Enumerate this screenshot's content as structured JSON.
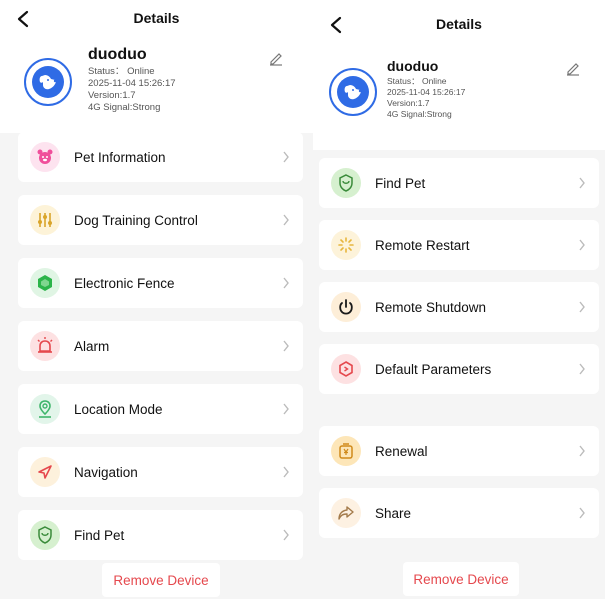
{
  "screens": [
    {
      "nav": {
        "title": "Details"
      },
      "device": {
        "name": "duoduo",
        "status": "Status： Online",
        "datetime": "2025-11-04 15:26:17",
        "version": "Version:1.7",
        "signal": "4G Signal:Strong"
      },
      "menu": [
        {
          "label": "Pet Information",
          "icon": "pet-face-icon",
          "color": "#f04f9b",
          "bg": "#fde3ef"
        },
        {
          "label": "Dog Training Control",
          "icon": "sliders-icon",
          "color": "#d9a52a",
          "bg": "#fdf3d8"
        },
        {
          "label": "Electronic Fence",
          "icon": "fence-icon",
          "color": "#2cb44a",
          "bg": "#e0f5e4"
        },
        {
          "label": "Alarm",
          "icon": "alarm-icon",
          "color": "#e5484d",
          "bg": "#fde1e2"
        },
        {
          "label": "Location Mode",
          "icon": "location-pin-icon",
          "color": "#3fb56b",
          "bg": "#e2f5ea"
        },
        {
          "label": "Navigation",
          "icon": "navigation-arrow-icon",
          "color": "#e5484d",
          "bg": "#fdf1dc"
        },
        {
          "label": "Find Pet",
          "icon": "find-pet-icon",
          "color": "#3a8b3a",
          "bg": "#d6f0cf"
        }
      ],
      "remove_label": "Remove Device"
    },
    {
      "nav": {
        "title": "Details"
      },
      "device": {
        "name": "duoduo",
        "status": "Status： Online",
        "datetime": "2025-11-04 15:26:17",
        "version": "Version:1.7",
        "signal": "4G Signal:Strong"
      },
      "menu": [
        {
          "label": "Find Pet",
          "icon": "find-pet-icon",
          "color": "#3a8b3a",
          "bg": "#d6f0cf"
        },
        {
          "label": "Remote Restart",
          "icon": "restart-icon",
          "color": "#e7b63c",
          "bg": "#fdf3da"
        },
        {
          "label": "Remote Shutdown",
          "icon": "power-icon",
          "color": "#1a1a1a",
          "bg": "#fdeed8"
        },
        {
          "label": "Default Parameters",
          "icon": "settings-hex-icon",
          "color": "#e5484d",
          "bg": "#fde1e2"
        },
        {
          "label": "Renewal",
          "icon": "renewal-icon",
          "color": "#d08a1a",
          "bg": "#fde6b8"
        },
        {
          "label": "Share",
          "icon": "share-icon",
          "color": "#a37a4a",
          "bg": "#fdf1e2"
        }
      ],
      "remove_label": "Remove Device"
    }
  ],
  "colors": {
    "accent": "#2f6be5",
    "danger": "#e5484d",
    "background": "#f5f5f5"
  }
}
